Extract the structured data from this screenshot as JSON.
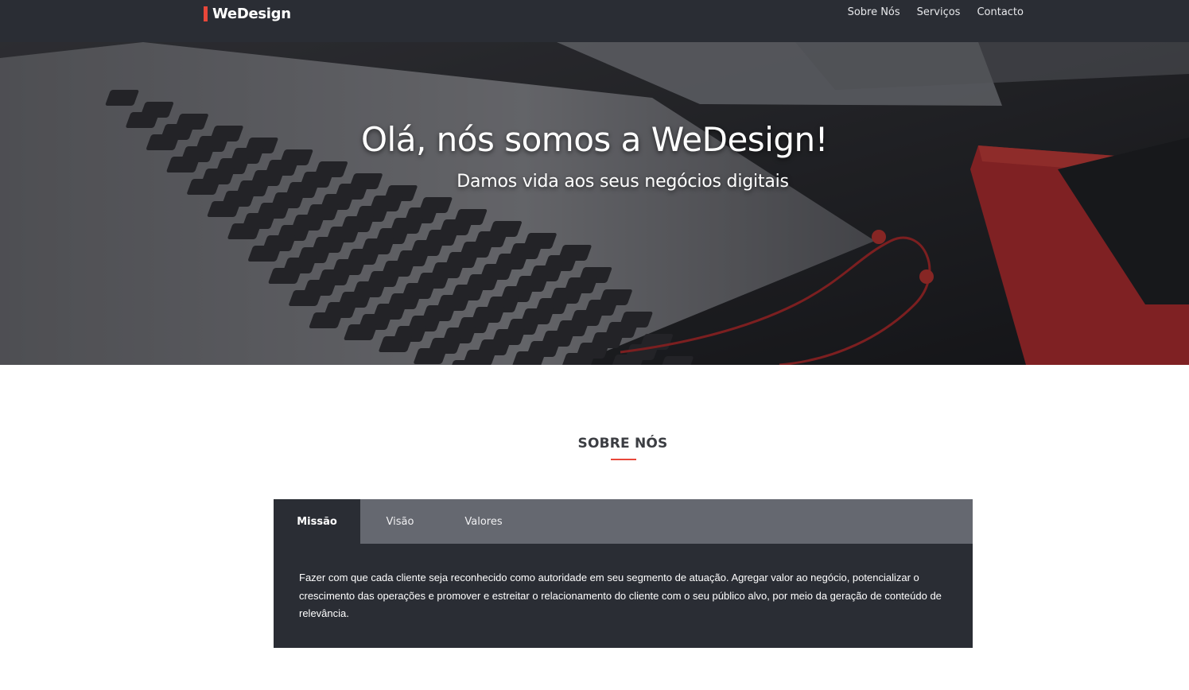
{
  "brand": {
    "name": "WeDesign",
    "accent_color": "#e8473a"
  },
  "nav": {
    "links": [
      {
        "label": "Sobre Nós"
      },
      {
        "label": "Serviços"
      },
      {
        "label": "Contacto"
      }
    ]
  },
  "hero": {
    "title": "Olá, nós somos a WeDesign!",
    "subtitle": "Damos vida aos seus negócios digitais"
  },
  "about": {
    "title": "SOBRE NÓS",
    "underline_color": "#e8473a",
    "tabs": [
      {
        "label": "Missão",
        "active": true
      },
      {
        "label": "Visão",
        "active": false
      },
      {
        "label": "Valores",
        "active": false
      }
    ],
    "content": "Fazer com que cada cliente seja reconhecido como autoridade em seu segmento de atuação. Agregar valor ao negócio, potencializar o crescimento das operações e promover e estreitar o relacionamento do cliente com o seu público alvo, por meio da geração de conteúdo de relevância."
  }
}
